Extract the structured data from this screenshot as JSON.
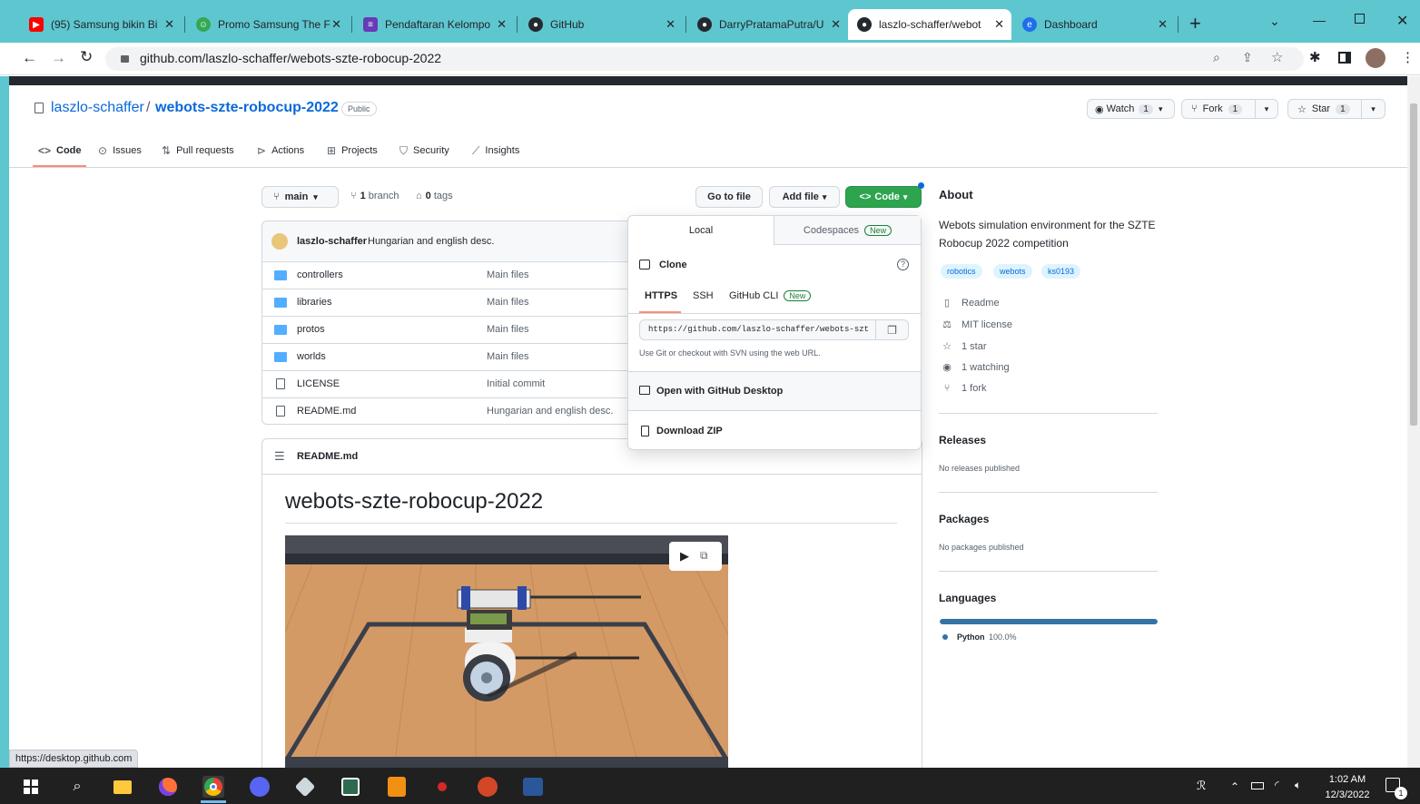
{
  "browser": {
    "tabs": [
      {
        "title": "(95) Samsung bikin Bi",
        "icon": "youtube-icon",
        "color": "#ff0000"
      },
      {
        "title": "Promo Samsung The F",
        "icon": "promo-icon",
        "color": "#34a853"
      },
      {
        "title": "Pendaftaran Kelompo",
        "icon": "forms-icon",
        "color": "#673ab7"
      },
      {
        "title": "GitHub",
        "icon": "github-icon",
        "color": "#24292f"
      },
      {
        "title": "DarryPratamaPutra/U",
        "icon": "github-icon",
        "color": "#24292f"
      },
      {
        "title": "laszlo-schaffer/webot",
        "icon": "github-icon",
        "color": "#24292f"
      },
      {
        "title": "Dashboard",
        "icon": "edge-icon",
        "color": "#1f6feb"
      }
    ],
    "url": "github.com/laszlo-schaffer/webots-szte-robocup-2022",
    "status_url": "https://desktop.github.com"
  },
  "repo": {
    "owner": "laszlo-schaffer",
    "slash": "/",
    "name": "webots-szte-robocup-2022",
    "visibility": "Public",
    "watch": {
      "label": "Watch",
      "count": "1"
    },
    "fork": {
      "label": "Fork",
      "count": "1"
    },
    "star": {
      "label": "Star",
      "count": "1"
    }
  },
  "nav": {
    "code": "Code",
    "issues": "Issues",
    "pulls": "Pull requests",
    "actions": "Actions",
    "projects": "Projects",
    "security": "Security",
    "insights": "Insights"
  },
  "branchbar": {
    "branch": "main",
    "branches_count": "1",
    "branches_label": "branch",
    "tags_count": "0",
    "tags_label": "tags",
    "go_to_file": "Go to file",
    "add_file": "Add file",
    "code_button": "Code"
  },
  "commit": {
    "author": "laszlo-schaffer",
    "message": "Hungarian and english desc."
  },
  "files": [
    {
      "name": "controllers",
      "message": "Main files",
      "type": "folder"
    },
    {
      "name": "libraries",
      "message": "Main files",
      "type": "folder"
    },
    {
      "name": "protos",
      "message": "Main files",
      "type": "folder"
    },
    {
      "name": "worlds",
      "message": "Main files",
      "type": "folder"
    },
    {
      "name": "LICENSE",
      "message": "Initial commit",
      "type": "file"
    },
    {
      "name": "README.md",
      "message": "Hungarian and english desc.",
      "type": "file"
    }
  ],
  "readme": {
    "filename": "README.md",
    "heading": "webots-szte-robocup-2022"
  },
  "code_dropdown": {
    "tab_local": "Local",
    "tab_codespaces": "Codespaces",
    "new_badge": "New",
    "clone_label": "Clone",
    "proto_https": "HTTPS",
    "proto_ssh": "SSH",
    "proto_cli": "GitHub CLI",
    "clone_url": "https://github.com/laszlo-schaffer/webots-szt",
    "hint": "Use Git or checkout with SVN using the web URL.",
    "open_desktop": "Open with GitHub Desktop",
    "download_zip": "Download ZIP"
  },
  "about": {
    "title": "About",
    "description": "Webots simulation environment for the SZTE Robocup 2022 competition",
    "topics": [
      "robotics",
      "webots",
      "ks0193"
    ],
    "readme": "Readme",
    "license": "MIT license",
    "stars": "1 star",
    "watching": "1 watching",
    "forks": "1 fork"
  },
  "releases": {
    "title": "Releases",
    "text": "No releases published"
  },
  "packages": {
    "title": "Packages",
    "text": "No packages published"
  },
  "languages": {
    "title": "Languages",
    "name": "Python",
    "percent": "100.0%",
    "fraction": 1.0,
    "color": "#3572a5"
  },
  "taskbar": {
    "time": "1:02 AM",
    "date": "12/3/2022",
    "notif_count": "1"
  }
}
